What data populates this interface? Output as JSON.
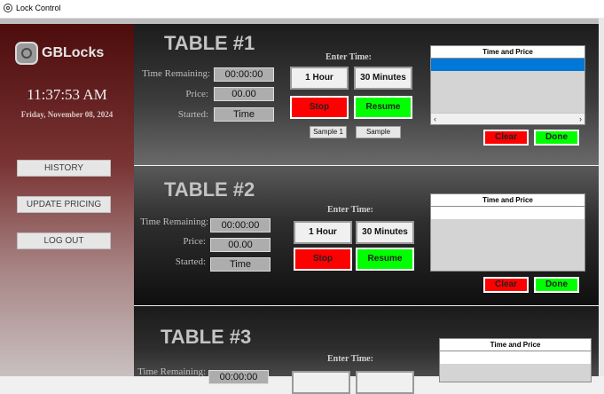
{
  "window": {
    "title": "Lock Control"
  },
  "sidebar": {
    "brand": "GBLocks",
    "time": "11:37:53 AM",
    "date": "Friday, November 08, 2024",
    "buttons": {
      "history": "HISTORY",
      "update_pricing": "UPDATE PRICING",
      "logout": "LOG OUT"
    }
  },
  "labels": {
    "time_remaining": "Time Remaining:",
    "price": "Price:",
    "started": "Started:",
    "enter_time": "Enter Time:",
    "btn_1hour": "1 Hour",
    "btn_30min": "30 Minutes",
    "btn_stop": "Stop",
    "btn_resume": "Resume",
    "btn_clear": "Clear",
    "btn_done": "Done",
    "list_header": "Time and Price"
  },
  "tables": [
    {
      "title": "TABLE #1",
      "time_remaining": "00:00:00",
      "price": "00.00",
      "started": "Time",
      "sample_buttons": [
        "Sample 1",
        "Sample"
      ]
    },
    {
      "title": "TABLE #2",
      "time_remaining": "00:00:00",
      "price": "00.00",
      "started": "Time"
    },
    {
      "title": "TABLE #3",
      "time_remaining": "00:00:00"
    }
  ],
  "colors": {
    "stop": "#ff0000",
    "resume": "#00ff00",
    "selection": "#0078d7"
  }
}
